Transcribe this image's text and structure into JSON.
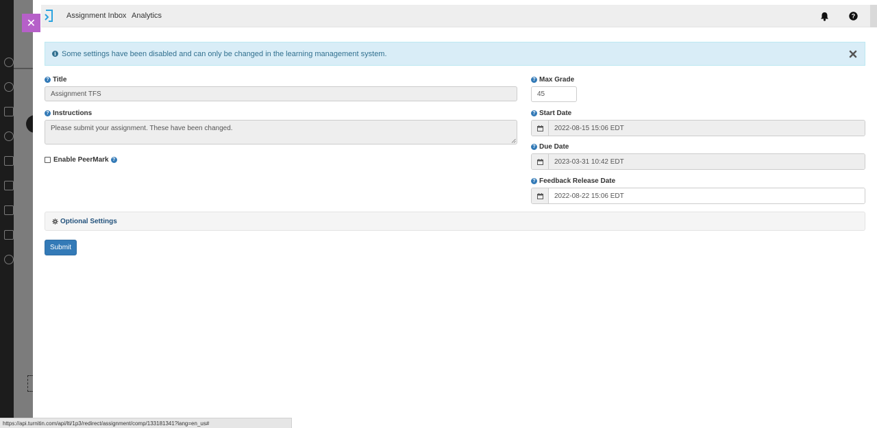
{
  "close_tab": {
    "symbol": "✕"
  },
  "nav": {
    "links": [
      "Assignment Inbox",
      "Analytics"
    ],
    "icons": [
      "bell-icon",
      "help-icon",
      "gear-icon"
    ]
  },
  "alert": {
    "text": "Some settings have been disabled and can only be changed in the learning management system."
  },
  "form": {
    "title_label": "Title",
    "title_value": "Assignment TFS",
    "instructions_label": "Instructions",
    "instructions_value": "Please submit your assignment.  These have been changed.",
    "peermark_label": "Enable PeerMark",
    "max_grade_label": "Max Grade",
    "max_grade_value": "45",
    "start_date_label": "Start Date",
    "start_date_value": "2022-08-15 15:06 EDT",
    "due_date_label": "Due Date",
    "due_date_value": "2023-03-31 10:42 EDT",
    "feedback_date_label": "Feedback Release Date",
    "feedback_date_value": "2022-08-22 15:06 EDT",
    "optional_settings_label": "Optional Settings",
    "submit_label": "Submit"
  },
  "statusbar": {
    "url": "https://api.turnitin.com/api/lti/1p3/redirect/assignment/comp/133181341?lang=en_us#"
  },
  "colors": {
    "accent_primary": "#337ab7",
    "close_tab": "#b660c9",
    "alert_bg": "#d9edf7",
    "alert_text": "#31708f"
  }
}
